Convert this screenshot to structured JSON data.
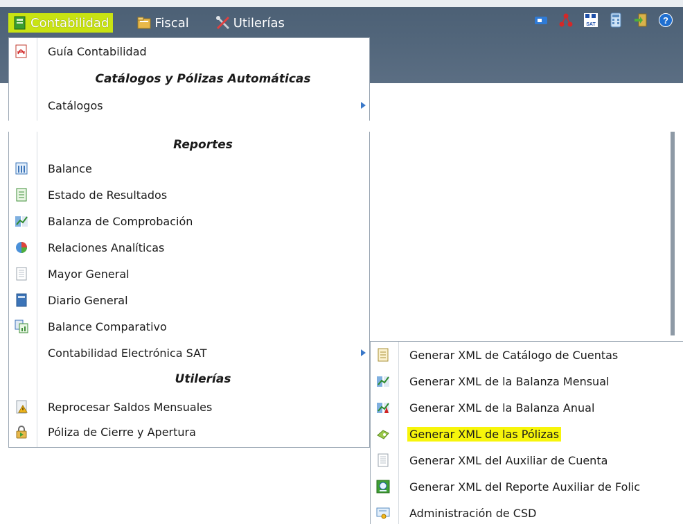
{
  "menubar": {
    "items": [
      {
        "label": "Contabilidad",
        "icon": "book-icon",
        "active": true
      },
      {
        "label": "Fiscal",
        "icon": "folder-icon",
        "active": false
      },
      {
        "label": "Utilerías",
        "icon": "tools-icon",
        "active": false
      }
    ]
  },
  "toolbar": {
    "icons": [
      "video-icon",
      "network-icon",
      "sat-icon",
      "calculator-icon",
      "exit-icon",
      "help-icon"
    ],
    "sat_label": "SAT"
  },
  "menu": {
    "items": [
      {
        "type": "item",
        "label": "Guía Contabilidad",
        "icon": "pdf-icon"
      },
      {
        "type": "header",
        "label": "Catálogos y Pólizas Automáticas"
      },
      {
        "type": "item",
        "label": "Catálogos",
        "icon": "",
        "submenu": true
      },
      {
        "type": "header",
        "label": "Reportes"
      },
      {
        "type": "item",
        "label": "Balance",
        "icon": "balance-icon"
      },
      {
        "type": "item",
        "label": "Estado de Resultados",
        "icon": "document-icon"
      },
      {
        "type": "item",
        "label": "Balanza de Comprobación",
        "icon": "chart-icon"
      },
      {
        "type": "item",
        "label": "Relaciones Analíticas",
        "icon": "pie-icon"
      },
      {
        "type": "item",
        "label": "Mayor General",
        "icon": "page-icon"
      },
      {
        "type": "item",
        "label": "Diario General",
        "icon": "journal-icon"
      },
      {
        "type": "item",
        "label": "Balance Comparativo",
        "icon": "compare-icon"
      },
      {
        "type": "item",
        "label": "Contabilidad Electrónica SAT",
        "icon": "",
        "submenu": true
      },
      {
        "type": "header",
        "label": "Utilerías"
      },
      {
        "type": "item",
        "label": "Reprocesar Saldos Mensuales",
        "icon": "warning-icon"
      },
      {
        "type": "item",
        "label": "Póliza de Cierre y Apertura",
        "icon": "lock-icon"
      }
    ]
  },
  "submenu": {
    "items": [
      {
        "label": "Generar XML de Catálogo de Cuentas",
        "icon": "catalog-icon",
        "highlight": false
      },
      {
        "label": "Generar XML de la Balanza Mensual",
        "icon": "chart-icon",
        "highlight": false
      },
      {
        "label": "Generar XML de la Balanza Anual",
        "icon": "chart-red-icon",
        "highlight": false
      },
      {
        "label": "Generar XML de las Pólizas",
        "icon": "policy-icon",
        "highlight": true
      },
      {
        "label": "Generar XML del Auxiliar de Cuenta",
        "icon": "page-icon",
        "highlight": false
      },
      {
        "label": "Generar XML del Reporte Auxiliar de Folic",
        "icon": "report-icon",
        "highlight": false
      },
      {
        "label": "Administración de CSD",
        "icon": "certificate-icon",
        "highlight": false
      }
    ]
  },
  "colors": {
    "topbar": "#52667b",
    "active_menu": "#c9e312",
    "highlight": "#f7f50b",
    "menu_border": "#9aa6b3"
  }
}
